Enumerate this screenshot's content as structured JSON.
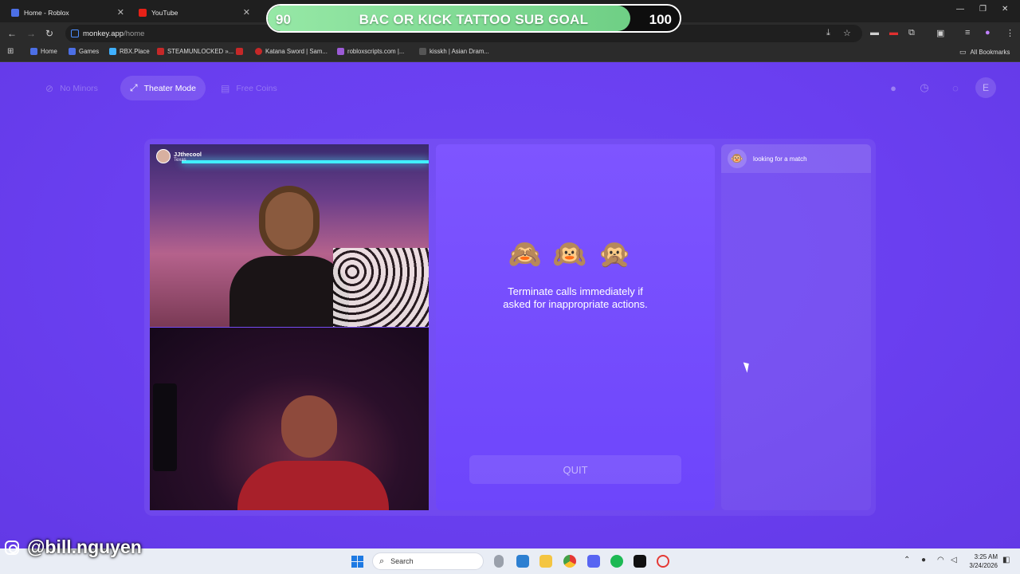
{
  "browser": {
    "tabs": [
      {
        "title": "Home - Roblox"
      },
      {
        "title": "YouTube"
      }
    ],
    "url_host": "monkey.app",
    "url_path": "/home",
    "bookmarks": [
      "Home",
      "Games",
      "RBX.Place",
      "STEAMUNLOCKED »...",
      "Katana Sword | Sam...",
      "robloxscripts.com |...",
      "kisskh | Asian Dram..."
    ],
    "all_bookmarks": "All Bookmarks"
  },
  "goal_overlay": {
    "start": "90",
    "label": "BAC OR KICK TATTOO SUB GOAL",
    "end": "100",
    "progress_fraction": 0.88,
    "fill_color": "#8fe4a0"
  },
  "app": {
    "nav": {
      "no_minors": "No Minors",
      "theater_mode": "Theater Mode",
      "free_coins": "Free Coins",
      "avatar_initial": "E"
    },
    "video_top": {
      "username": "JJthecool",
      "location": "Texas"
    },
    "center": {
      "emojis": "🙈🙉🙊",
      "rule": "Terminate calls immediately if asked for inappropriate actions.",
      "quit": "QUIT"
    },
    "side": {
      "status_icon": "🐵",
      "status": "looking for a match"
    }
  },
  "watermark": {
    "handle": "@bill.nguyen"
  },
  "taskbar": {
    "search": "Search",
    "time": "3:25 AM",
    "date": "3/24/2026"
  },
  "colors": {
    "page_bg": "#6a3ff0",
    "panel": "#7a52ff",
    "accent_green": "#8fe4a0"
  }
}
